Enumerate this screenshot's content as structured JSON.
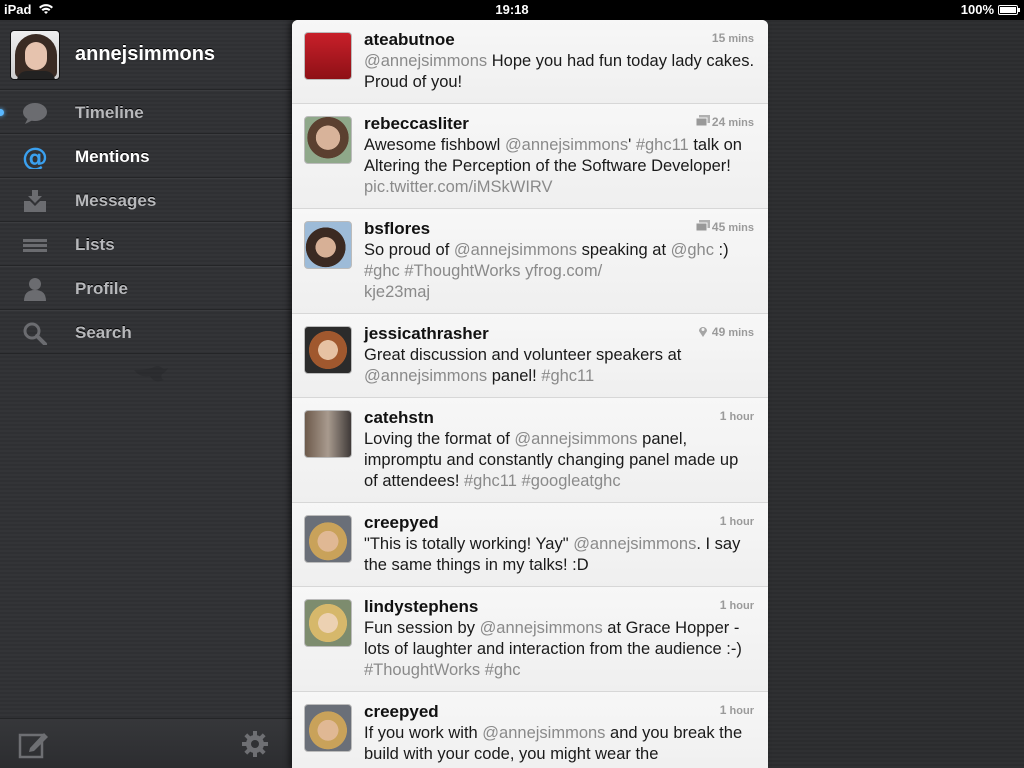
{
  "status_bar": {
    "device": "iPad",
    "time": "19:18",
    "battery_percent": "100%",
    "battery_level": 1.0
  },
  "sidebar": {
    "username": "annejsimmons",
    "nav": [
      {
        "label": "Timeline",
        "icon": "speech-bubble-icon"
      },
      {
        "label": "Mentions",
        "icon": "at-icon",
        "active": true
      },
      {
        "label": "Messages",
        "icon": "inbox-icon"
      },
      {
        "label": "Lists",
        "icon": "list-icon"
      },
      {
        "label": "Profile",
        "icon": "person-icon"
      },
      {
        "label": "Search",
        "icon": "search-icon"
      }
    ]
  },
  "tweets": [
    {
      "user": "ateabutnoe",
      "time_num": "15",
      "time_unit": "mins",
      "meta": "",
      "parts": [
        {
          "t": "@annejsimmons",
          "hl": true
        },
        {
          "t": " Hope you had fun today lady cakes. Proud of you!"
        }
      ]
    },
    {
      "user": "rebeccasliter",
      "time_num": "24",
      "time_unit": "mins",
      "meta": "media",
      "parts": [
        {
          "t": "Awesome fishbowl "
        },
        {
          "t": "@annejsimmons",
          "hl": true
        },
        {
          "t": "' "
        },
        {
          "t": "#ghc11",
          "hl": true
        },
        {
          "t": " talk on Altering the Perception of the Software Developer! "
        },
        {
          "t": "pic.twitter.com/iMSkWIRV",
          "hl": true
        }
      ]
    },
    {
      "user": "bsflores",
      "time_num": "45",
      "time_unit": "mins",
      "meta": "media",
      "parts": [
        {
          "t": "So proud of "
        },
        {
          "t": "@annejsimmons",
          "hl": true
        },
        {
          "t": " speaking at "
        },
        {
          "t": "@ghc",
          "hl": true
        },
        {
          "t": " :) "
        },
        {
          "t": "#ghc",
          "hl": true
        },
        {
          "t": " "
        },
        {
          "t": "#ThoughtWorks",
          "hl": true
        },
        {
          "t": " "
        },
        {
          "t": "yfrog.com/\nkje23maj",
          "hl": true
        }
      ]
    },
    {
      "user": "jessicathrasher",
      "time_num": "49",
      "time_unit": "mins",
      "meta": "location",
      "parts": [
        {
          "t": "Great discussion and volunteer speakers at "
        },
        {
          "t": "@annejsimmons",
          "hl": true
        },
        {
          "t": " panel! "
        },
        {
          "t": "#ghc11",
          "hl": true
        }
      ]
    },
    {
      "user": "catehstn",
      "time_num": "1",
      "time_unit": "hour",
      "meta": "",
      "parts": [
        {
          "t": "Loving the format of "
        },
        {
          "t": "@annejsimmons",
          "hl": true
        },
        {
          "t": " panel, impromptu and constantly changing panel made up of attendees! "
        },
        {
          "t": "#ghc11",
          "hl": true
        },
        {
          "t": " "
        },
        {
          "t": "#googleatghc",
          "hl": true
        }
      ]
    },
    {
      "user": "creepyed",
      "time_num": "1",
      "time_unit": "hour",
      "meta": "",
      "parts": [
        {
          "t": "\"This is totally working! Yay\" "
        },
        {
          "t": "@annejsimmons",
          "hl": true
        },
        {
          "t": ". I say the same things in my talks!  :D"
        }
      ]
    },
    {
      "user": "lindystephens",
      "time_num": "1",
      "time_unit": "hour",
      "meta": "",
      "parts": [
        {
          "t": "Fun session by "
        },
        {
          "t": "@annejsimmons",
          "hl": true
        },
        {
          "t": " at Grace Hopper - lots of laughter and interaction from the audience :-) "
        },
        {
          "t": "#ThoughtWorks",
          "hl": true
        },
        {
          "t": " "
        },
        {
          "t": "#ghc",
          "hl": true
        }
      ]
    },
    {
      "user": "creepyed",
      "time_num": "1",
      "time_unit": "hour",
      "meta": "",
      "parts": [
        {
          "t": "If you work with "
        },
        {
          "t": "@annejsimmons",
          "hl": true
        },
        {
          "t": " and you break the build with your code, you might wear the"
        }
      ]
    }
  ]
}
